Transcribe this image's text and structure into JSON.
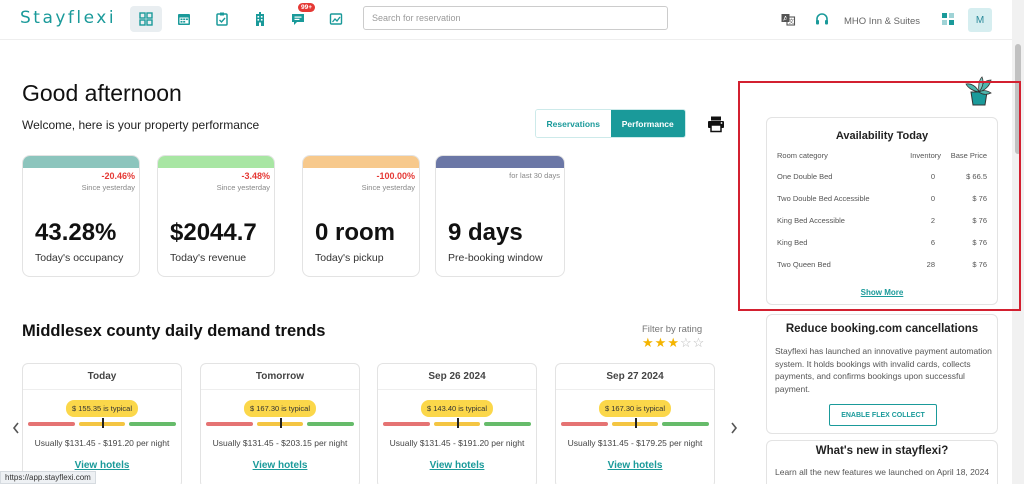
{
  "header": {
    "logo": "Stayflexi",
    "search_placeholder": "Search for reservation",
    "hotel_name": "MHO Inn & Suites",
    "avatar_initial": "M",
    "notification_count": "99+",
    "icons": [
      "dashboard-icon",
      "calendar-icon",
      "clipboard-icon",
      "hotel-icon",
      "chat-icon",
      "reports-icon",
      "translate-icon",
      "headset-icon",
      "apps-icon"
    ]
  },
  "greeting": {
    "title": "Good afternoon",
    "subtitle": "Welcome, here is your property performance"
  },
  "tabs": [
    {
      "label": "Reservations",
      "active": false
    },
    {
      "label": "Performance",
      "active": true
    }
  ],
  "metrics": [
    {
      "change": "-20.46%",
      "since": "Since yesterday",
      "value": "43.28%",
      "label": "Today's occupancy",
      "color": "#8cc5bd"
    },
    {
      "change": "-3.48%",
      "since": "Since yesterday",
      "value": "$2044.7",
      "label": "Today's revenue",
      "color": "#a8e6a3"
    },
    {
      "change": "-100.00%",
      "since": "Since yesterday",
      "value": "0 room",
      "label": "Today's pickup",
      "color": "#f7c98c"
    },
    {
      "change": "",
      "since": "for last 30 days",
      "value": "9 days",
      "label": "Pre-booking window",
      "color": "#6b77a6"
    }
  ],
  "demand": {
    "title": "Middlesex county daily demand trends",
    "filter_label": "Filter by rating",
    "rating": 3,
    "rating_max": 5,
    "days": [
      {
        "day": "Today",
        "typical": "$ 155.35 is typical",
        "usual": "Usually $131.45 - $191.20 per night",
        "link": "View hotels"
      },
      {
        "day": "Tomorrow",
        "typical": "$ 167.30 is typical",
        "usual": "Usually $131.45 - $203.15 per night",
        "link": "View hotels"
      },
      {
        "day": "Sep 26 2024",
        "typical": "$ 143.40 is typical",
        "usual": "Usually $131.45 - $191.20 per night",
        "link": "View hotels"
      },
      {
        "day": "Sep 27 2024",
        "typical": "$ 167.30 is typical",
        "usual": "Usually $131.45 - $179.25 per night",
        "link": "View hotels"
      }
    ]
  },
  "availability": {
    "title": "Availability Today",
    "headers": {
      "category": "Room category",
      "inventory": "Inventory",
      "price": "Base Price"
    },
    "rows": [
      {
        "category": "One Double Bed",
        "inventory": "0",
        "price": "$ 66.5"
      },
      {
        "category": "Two Double Bed Accessible",
        "inventory": "0",
        "price": "$ 76"
      },
      {
        "category": "King Bed Accessible",
        "inventory": "2",
        "price": "$ 76"
      },
      {
        "category": "King Bed",
        "inventory": "6",
        "price": "$ 76"
      },
      {
        "category": "Two Queen Bed",
        "inventory": "28",
        "price": "$ 76"
      }
    ],
    "show_more": "Show More"
  },
  "flex_collect": {
    "title": "Reduce booking.com cancellations",
    "text": "Stayflexi has launched an innovative payment automation system. It holds bookings with invalid cards, collects payments, and confirms bookings upon successful payment.",
    "button": "ENABLE FLEX COLLECT"
  },
  "whats_new": {
    "title": "What's new in stayflexi?",
    "text": "Learn all the new features we launched on April 18, 2024"
  },
  "status_url": "https://app.stayflexi.com"
}
